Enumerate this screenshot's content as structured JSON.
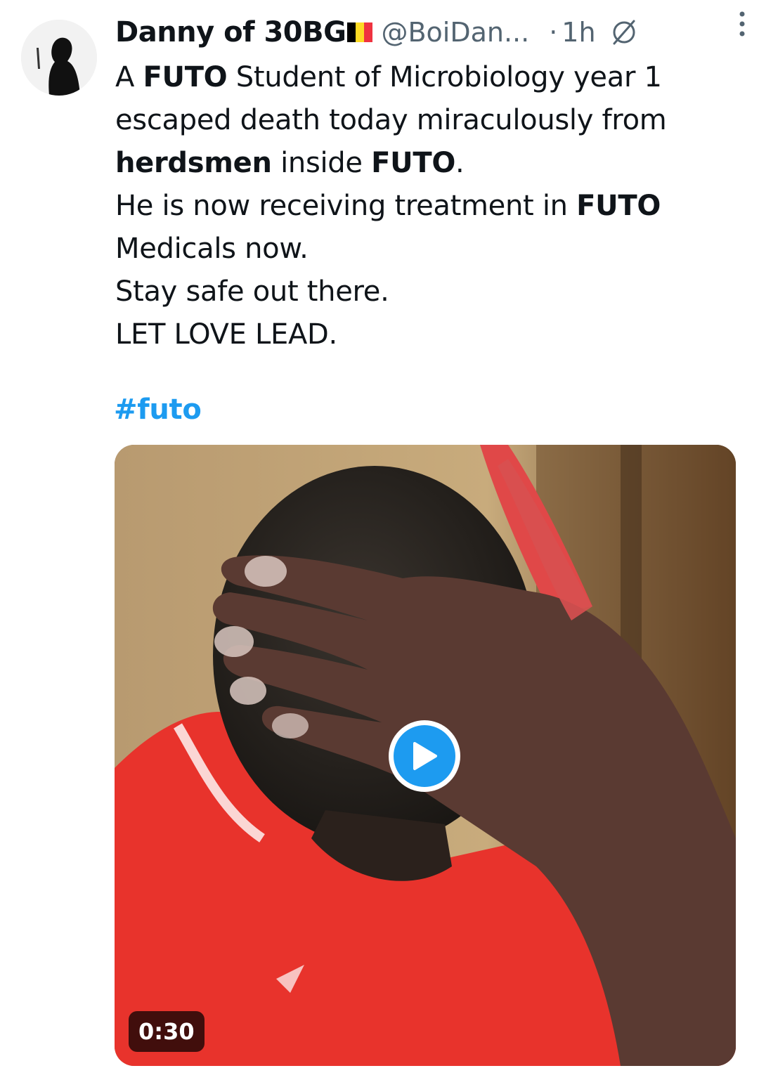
{
  "tweet": {
    "author": {
      "display_name": "Danny of 30BG",
      "handle": "@BoiDan...",
      "flag_colors": [
        "#000000",
        "#fdda24",
        "#ef3340"
      ]
    },
    "time_separator": "·",
    "timestamp": "1h",
    "lines": [
      {
        "parts": [
          {
            "text": "A ",
            "bold": false
          },
          {
            "text": "FUTO",
            "bold": true
          },
          {
            "text": " Student of Microbiology year 1",
            "bold": false
          }
        ]
      },
      {
        "parts": [
          {
            "text": "escaped death today miraculously from",
            "bold": false
          }
        ]
      },
      {
        "parts": [
          {
            "text": "herdsmen",
            "bold": true
          },
          {
            "text": " inside ",
            "bold": false
          },
          {
            "text": "FUTO",
            "bold": true
          },
          {
            "text": ".",
            "bold": false
          }
        ]
      },
      {
        "parts": [
          {
            "text": "He is now receiving treatment in ",
            "bold": false
          },
          {
            "text": "FUTO",
            "bold": true
          }
        ]
      },
      {
        "parts": [
          {
            "text": "Medicals now.",
            "bold": false
          }
        ]
      },
      {
        "parts": [
          {
            "text": "Stay safe out there.",
            "bold": false
          }
        ]
      },
      {
        "parts": [
          {
            "text": "LET LOVE LEAD.",
            "bold": false
          }
        ]
      }
    ],
    "hashtag": "#futo",
    "media": {
      "type": "video",
      "duration": "0:30"
    }
  },
  "icons": {
    "grok": "grok-icon",
    "more": "more-vertical-icon",
    "play": "play-icon"
  },
  "colors": {
    "accent": "#1d9bf0",
    "secondary_text": "#536471",
    "primary_text": "#0f1419"
  }
}
